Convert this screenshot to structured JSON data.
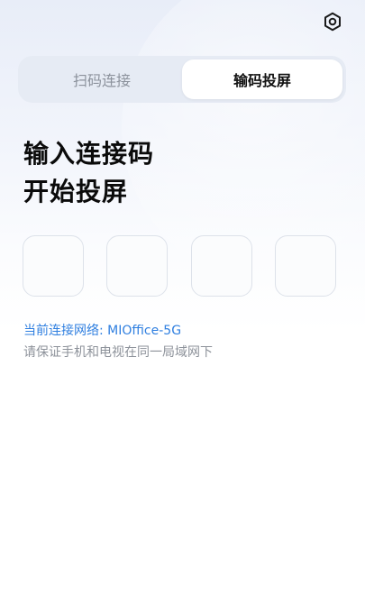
{
  "settings": {
    "icon": "gear-icon"
  },
  "tabs": [
    {
      "label": "扫码连接",
      "selected": false
    },
    {
      "label": "输码投屏",
      "selected": true
    }
  ],
  "headline": {
    "line1": "输入连接码",
    "line2": "开始投屏"
  },
  "code_inputs": [
    "",
    "",
    "",
    ""
  ],
  "network": {
    "text": "当前连接网络: MIOffice-5G"
  },
  "hint": "请保证手机和电视在同一局域网下",
  "colors": {
    "accent": "#2f7fe0",
    "tab_track": "#e6ebf4",
    "box_border": "#dde2ea"
  }
}
